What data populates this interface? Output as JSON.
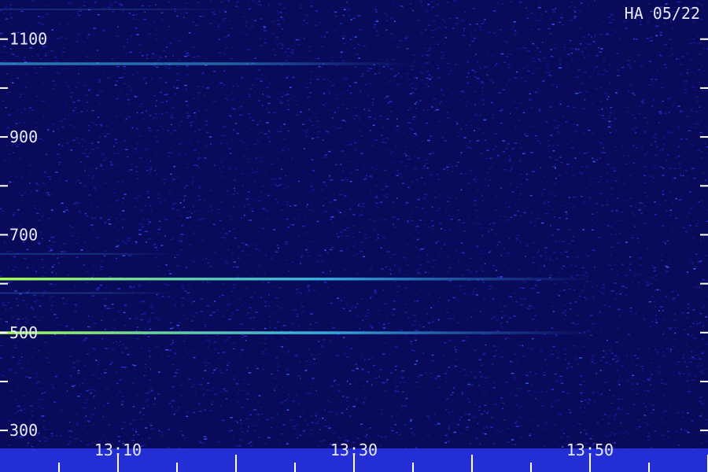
{
  "chart_data": {
    "type": "heatmap",
    "title": "HA 05/22",
    "x_ticks": [
      "13:10",
      "13:30",
      "13:50"
    ],
    "y_ticks": [
      "300",
      "500",
      "700",
      "900",
      "1100"
    ],
    "y_ticks_values": [
      300,
      500,
      700,
      900,
      1100
    ],
    "ylim": [
      260,
      1180
    ],
    "x_range_minutes": [
      13.0,
      14.0
    ],
    "lines": [
      {
        "y": 1050,
        "strength": 0.55,
        "fade_at": "13:35",
        "color": "#3fd6ff"
      },
      {
        "y": 610,
        "strength": 1.0,
        "fade_at": "13:50",
        "color": "#a8ff4a"
      },
      {
        "y": 500,
        "strength": 1.0,
        "fade_at": "13:50",
        "color": "#a8ff4a"
      },
      {
        "y": 660,
        "strength": 0.25,
        "fade_at": "13:15",
        "color": "#3fa0ff"
      },
      {
        "y": 580,
        "strength": 0.25,
        "fade_at": "13:15",
        "color": "#3fa0ff"
      },
      {
        "y": 1160,
        "strength": 0.2,
        "fade_at": "13:20",
        "color": "#3fa0ff"
      }
    ],
    "colors": {
      "background": "#0a0a5a",
      "noise": "#2a3cff",
      "tick": "#ffffff"
    }
  }
}
